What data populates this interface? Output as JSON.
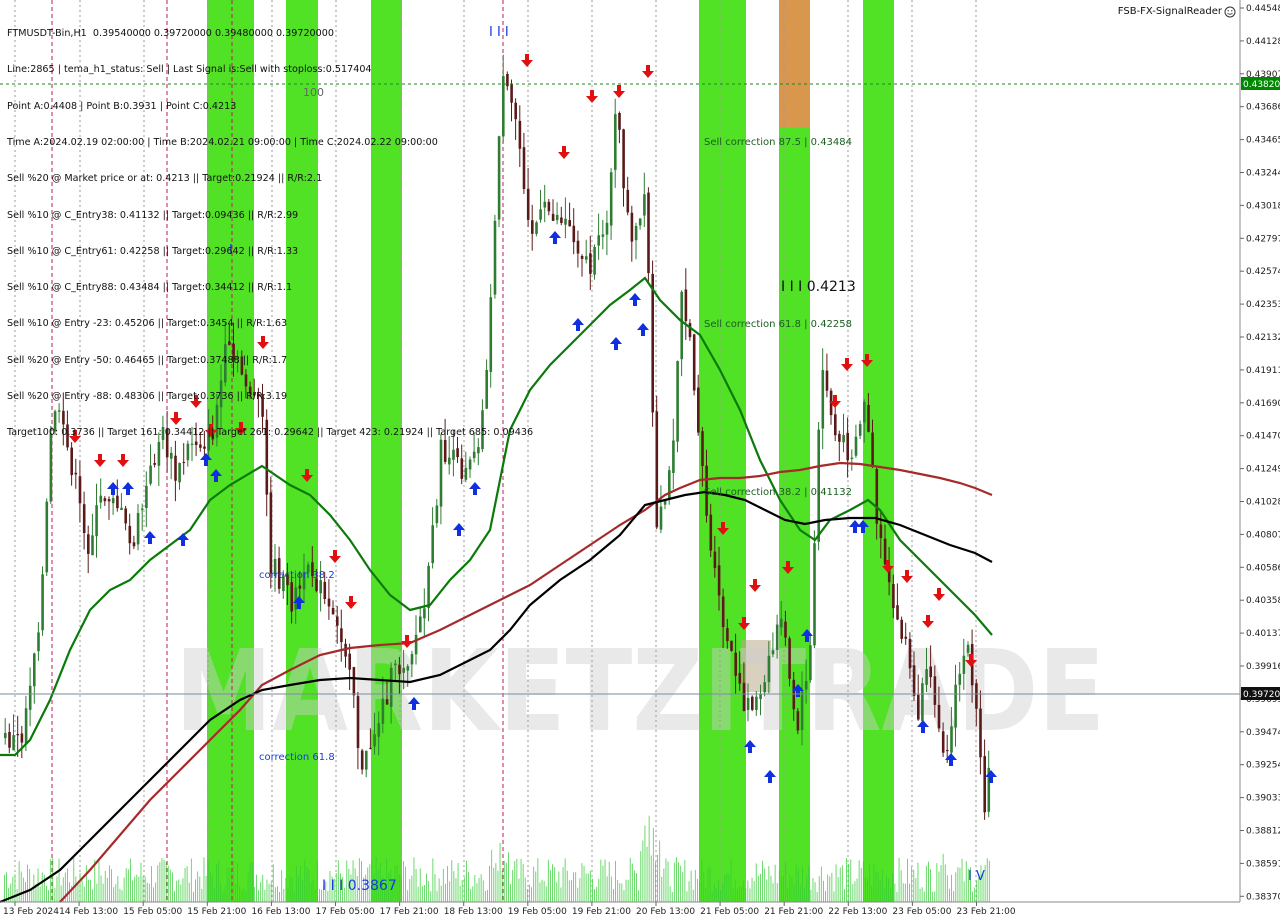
{
  "header": {
    "info_lines": [
      "FTMUSDT-Bin,H1  0.39540000 0.39720000 0.39480000 0.39720000",
      "Line:2865 | tema_h1_status: Sell | Last Signal is:Sell with stoploss:0.517404",
      "Point A:0.4408 | Point B:0.3931 | Point C:0.4213",
      "Time A:2024.02.19 02:00:00 | Time B:2024.02.21 09:00:00 | Time C:2024.02.22 09:00:00",
      "Sell %20 @ Market price or at: 0.4213 || Target:0.21924 || R/R:2.1",
      "Sell %10 @ C_Entry38: 0.41132 || Target:0.09436 || R/R:2.99",
      "Sell %10 @ C_Entry61: 0.42258 || Target:0.29642 || R/R:1.33",
      "Sell %10 @ C_Entry88: 0.43484 || Target:0.34412 || R/R:1.1",
      "Sell %10 @ Entry -23: 0.45206 || Target:0.3454 || R/R:1.63",
      "Sell %20 @ Entry -50: 0.46465 || Target:0.37488 || R/R:1.7",
      "Sell %20 @ Entry -88: 0.48306 || Target:0.3736 || R/R:3.19",
      "Target100: 0.3736 || Target 161: 0.34412 || Target 261: 0.29642 || Target 423: 0.21924 || Target 685: 0.09436"
    ],
    "brand": "FSB-FX-SignalReader",
    "brand_icon": "smiley-icon"
  },
  "price_axis": {
    "labels": [
      "0.44548",
      "0.44128",
      "0.43907",
      "0.43686",
      "0.43465",
      "0.43244",
      "0.43018",
      "0.42797",
      "0.42574",
      "0.42353",
      "0.42132",
      "0.41911",
      "0.41690",
      "0.41470",
      "0.41249",
      "0.41028",
      "0.40807",
      "0.40586",
      "0.40358",
      "0.40137",
      "0.39916",
      "0.39695",
      "0.39474",
      "0.39254",
      "0.39033",
      "0.38812",
      "0.38591",
      "0.38370"
    ],
    "current_price": "0.39720",
    "line_price": "0.43820"
  },
  "time_axis": {
    "labels": [
      "13 Feb 2024",
      "14 Feb 13:00",
      "15 Feb 05:00",
      "15 Feb 21:00",
      "16 Feb 13:00",
      "17 Feb 05:00",
      "17 Feb 21:00",
      "18 Feb 13:00",
      "19 Feb 05:00",
      "19 Feb 21:00",
      "20 Feb 13:00",
      "21 Feb 05:00",
      "21 Feb 21:00",
      "22 Feb 13:00",
      "23 Feb 05:00",
      "23 Feb 21:00"
    ]
  },
  "annotations": {
    "level_100": "100",
    "sell_correction_875": "Sell correction 87.5 | 0.43484",
    "sell_correction_618": "Sell correction 61.8 | 0.42258",
    "sell_correction_382": "Sell correction 38.2 | 0.41132",
    "point_c": "I I I 0.4213",
    "correction_382": "correction 38.2",
    "correction_618": "correction 61.8",
    "point_b": "I I I 0.3867",
    "wave_iii": "I I I",
    "wave_iv": "I V",
    "wave_i": "I"
  },
  "watermark": "MARKETZITRADE",
  "colors": {
    "background": "#ffffff",
    "green_band": "#33dd00",
    "orange_band": "#d9964d",
    "bull_candle": "#2e7d32",
    "bear_candle": "#5b1a1a",
    "ma_green": "#0b7a0b",
    "ma_red": "#a52a2a",
    "ma_black": "#000000",
    "buy_arrow": "#1030e0",
    "sell_arrow": "#e01010",
    "volume": "#33cc33",
    "price_tag_bg": "#008800",
    "current_tag_bg": "#111111"
  },
  "chart_data": {
    "type": "candlestick",
    "symbol": "FTMUSDT-Bin",
    "timeframe": "H1",
    "ylim": [
      0.3837,
      0.4456
    ],
    "ohlc": {
      "open": 0.3954,
      "high": 0.3972,
      "low": 0.3948,
      "close": 0.3972
    },
    "levels": {
      "point_a": 0.4408,
      "point_b": 0.3931,
      "point_c": 0.4213,
      "horizontal_line": 0.4382,
      "current": 0.3972
    }
  }
}
